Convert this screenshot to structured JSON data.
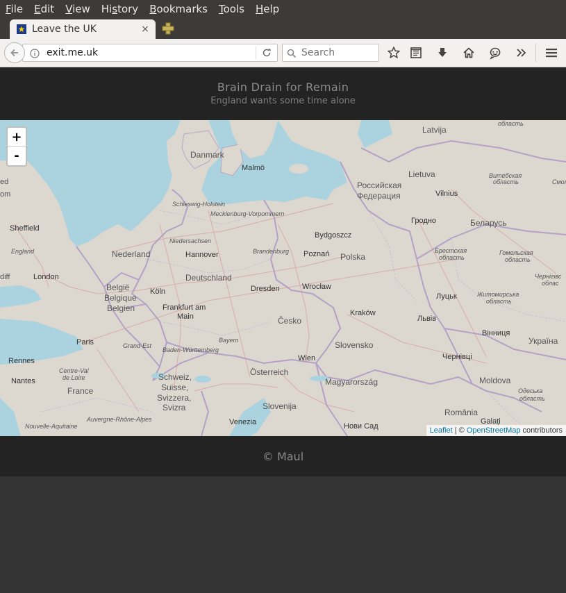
{
  "menu": [
    "File",
    "Edit",
    "View",
    "History",
    "Bookmarks",
    "Tools",
    "Help"
  ],
  "tab": {
    "title": "Leave the UK",
    "close": "×"
  },
  "navbar": {
    "url": "exit.me.uk",
    "search_placeholder": "Search"
  },
  "page": {
    "title": "Brain Drain for Remain",
    "subtitle": "England wants some time alone",
    "footer": "© Maul"
  },
  "map": {
    "zoom_in": "+",
    "zoom_out": "-",
    "attribution": {
      "leaflet": "Leaflet",
      "sep": " | © ",
      "osm": "OpenStreetMap",
      "suffix": " contributors"
    },
    "labels": {
      "latvija": "Latvija",
      "danmark": "Danmark",
      "malmo": "Malmö",
      "lietuva": "Lietuva",
      "vilnius": "Vilnius",
      "rossiya": "Российская",
      "federatsiya": "Федерация",
      "vitebsk1": "Витебская",
      "vitebsk2": "область",
      "smol": "Смол",
      "obl_top": "область",
      "sheffield": "Sheffield",
      "england": "England",
      "london": "London",
      "uk_ed": "ed",
      "uk_om": "om",
      "diff": "diff",
      "schleswig": "Schleswig-Holstein",
      "mecklenburg": "Mecklenburg-Vorpommern",
      "bydgoszcz": "Bydgoszcz",
      "grodno": "Гродно",
      "belarus": "Беларусь",
      "niedersachsen": "Niedersachsen",
      "nederland": "Nederland",
      "hannover": "Hannover",
      "brandenburg": "Brandenburg",
      "poznan": "Poznań",
      "polska": "Polska",
      "brest1": "Брестская",
      "brest2": "область",
      "gomel1": "Гомельская",
      "gomel2": "область",
      "belgie1": "België",
      "belgie2": "Belgique",
      "belgie3": "Belgien",
      "koln": "Köln",
      "deutschland": "Deutschland",
      "dresden": "Dresden",
      "wroclaw": "Wrocław",
      "lutsk": "Луцьк",
      "zhytomyr1": "Житомирська",
      "zhytomyr2": "область",
      "chernihiv1": "Чернігівс",
      "chernihiv2": "облас",
      "frankfurt1": "Frankfurt am",
      "frankfurt2": "Main",
      "cesko": "Česko",
      "krakow": "Kraków",
      "lviv": "Львів",
      "paris": "Paris",
      "grandest": "Grand-Est",
      "bayern": "Bayern",
      "vinnytsia": "Вінниця",
      "ukraina": "Україна",
      "rennes": "Rennes",
      "bw": "Baden-Württemberg",
      "slovensko": "Slovensko",
      "wien": "Wien",
      "chernivtsi": "Чернівці",
      "centre1": "Centre-Val",
      "centre2": "de Loire",
      "nantes": "Nantes",
      "schweiz1": "Schweiz,",
      "schweiz2": "Suisse,",
      "schweiz3": "Svizzera,",
      "schweiz4": "Svizra",
      "osterreich": "Österreich",
      "magyar": "Magyarország",
      "moldova": "Moldova",
      "odessa1": "Одеська",
      "odessa2": "область",
      "france": "France",
      "slovenija": "Slovenija",
      "romania": "România",
      "nouvelle": "Nouvelle-Aquitaine",
      "auvergne": "Auvergne-Rhône-Alpes",
      "venezia": "Venezia",
      "novisad": "Нови Сад",
      "galati": "Galați"
    }
  }
}
